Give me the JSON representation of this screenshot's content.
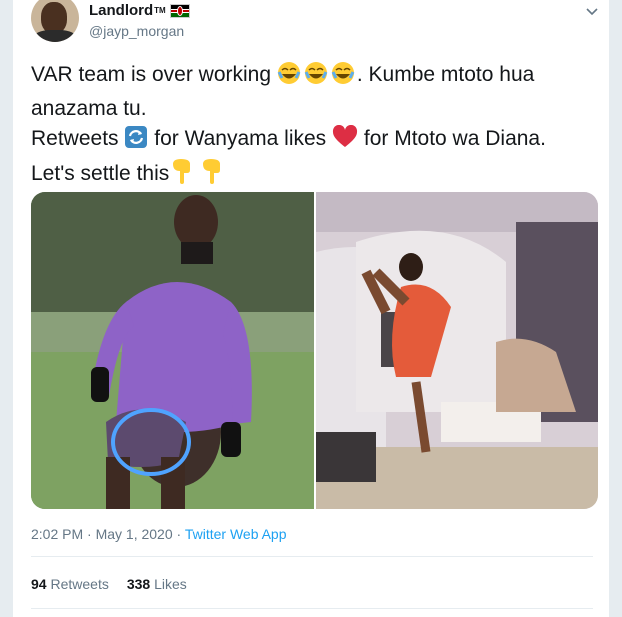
{
  "user": {
    "display_name": "Landlord",
    "tm": "TM",
    "handle": "@jayp_morgan",
    "flag_icon": "kenya-flag-icon"
  },
  "tweet": {
    "line1": "VAR team is over working",
    "line1b": ". Kumbe mtoto hua anazama tu.",
    "line2a": "Retweets",
    "line2b": "for Wanyama likes",
    "line2c": "for Mtoto wa Diana.",
    "line3": "Let's settle this"
  },
  "meta": {
    "time": "2:02 PM · May 1, 2020 ·",
    "source": "Twitter Web App"
  },
  "stats": {
    "retweets_count": "94",
    "retweets_label": "Retweets",
    "likes_count": "338",
    "likes_label": "Likes"
  },
  "colors": {
    "accent": "#1da1f2",
    "text": "#14171a",
    "muted": "#657786",
    "heart": "#e0245e"
  }
}
